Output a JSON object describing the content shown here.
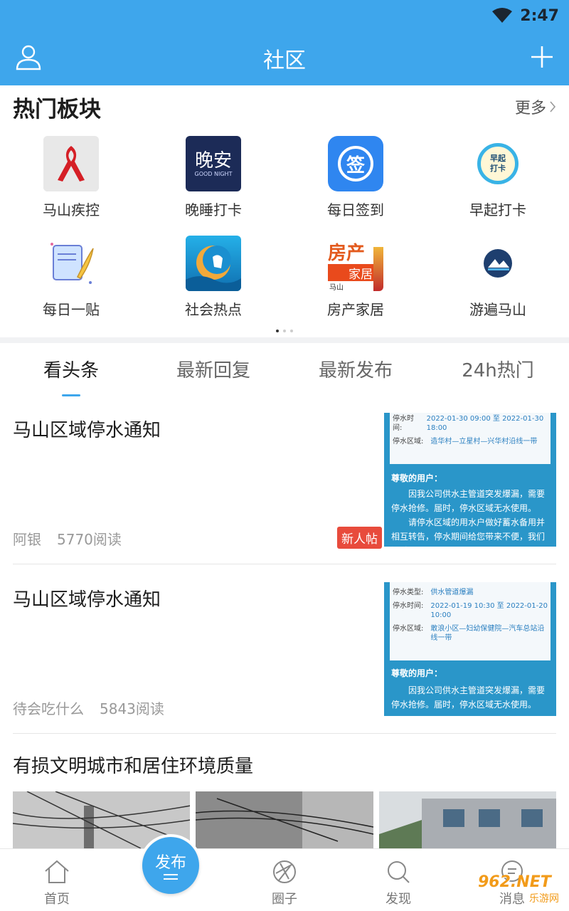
{
  "status": {
    "time": "2:47"
  },
  "header": {
    "title": "社区"
  },
  "hot": {
    "title": "热门板块",
    "more": "更多",
    "items": [
      {
        "label": "马山疾控"
      },
      {
        "label": "晚睡打卡",
        "thumb_text": "晚安",
        "thumb_sub": "GOOD NIGHT"
      },
      {
        "label": "每日签到",
        "thumb_text": "签"
      },
      {
        "label": "早起打卡",
        "thumb_text": "早起",
        "thumb_text2": "打卡"
      },
      {
        "label": "每日一贴"
      },
      {
        "label": "社会热点"
      },
      {
        "label": "房产家居",
        "thumb_text": "房产",
        "thumb_text2": "家居",
        "thumb_text3": "马山"
      },
      {
        "label": "游遍马山"
      }
    ]
  },
  "tabs": [
    "看头条",
    "最新回复",
    "最新发布",
    "24h热门"
  ],
  "posts": [
    {
      "title": "马山区域停水通知",
      "author": "阿银",
      "reads": "5770阅读",
      "badge": "新人帖",
      "notice": {
        "time_label": "停水时间:",
        "time_value": "2022-01-30 09:00 至 2022-01-30 18:00",
        "area_label": "停水区域:",
        "area_value": "造华村—立星村—兴华村沿线一带",
        "greeting": "尊敬的用户：",
        "body1": "因我公司供水主管道突发爆漏，需要停水抢修。届时，停水区域无水使用。",
        "body2": "请停水区域的用水户做好蓄水备用并相互转告，停水期间给您带来不便，我们深感"
      }
    },
    {
      "title": "马山区域停水通知",
      "author": "待会吃什么",
      "reads": "5843阅读",
      "notice": {
        "type_label": "停水类型:",
        "type_value": "供水管道爆漏",
        "time_label": "停水时间:",
        "time_value": "2022-01-19 10:30 至 2022-01-20 10:00",
        "area_label": "停水区域:",
        "area_value": "敢浪小区—妇幼保健院—汽车总站沿线一带",
        "greeting": "尊敬的用户：",
        "body1": "因我公司供水主管道突发爆漏，需要停水抢修。届时，停水区域无水使用。"
      }
    },
    {
      "title": "有损文明城市和居住环境质量"
    }
  ],
  "nav": {
    "home": "首页",
    "publish": "发布",
    "circle": "圈子",
    "discover": "发现",
    "messages": "消息"
  },
  "watermark": {
    "line1": "962.NET",
    "line2": "乐游网"
  },
  "colors": {
    "accent": "#3ea6ec",
    "badge": "#e84b3c"
  }
}
